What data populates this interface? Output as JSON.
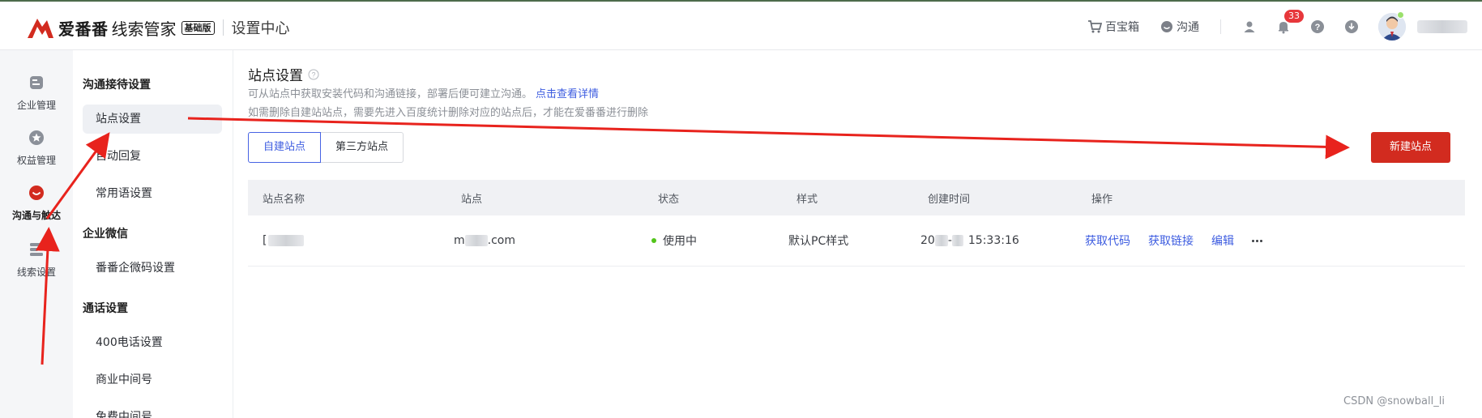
{
  "header": {
    "brand_name": "爱番番",
    "brand_sub": "线索管家",
    "edition": "基础版",
    "section_title": "设置中心",
    "links": [
      {
        "label": "百宝箱",
        "icon": "cart-icon"
      },
      {
        "label": "沟通",
        "icon": "chat-icon"
      }
    ],
    "notification_count": "33",
    "colors": {
      "brand_red": "#d22b1f"
    }
  },
  "rail": {
    "items": [
      {
        "label": "企业管理",
        "icon": "enterprise-icon"
      },
      {
        "label": "权益管理",
        "icon": "star-badge-icon"
      },
      {
        "label": "沟通与触达",
        "icon": "chat-bubble-icon",
        "active": true
      },
      {
        "label": "线索设置",
        "icon": "list-settings-icon"
      }
    ]
  },
  "submenu": {
    "group1": "沟通接待设置",
    "item_site": "站点设置",
    "item_autoreply": "自动回复",
    "item_phrases": "常用语设置",
    "group2": "企业微信",
    "item_wecom_code": "番番企微码设置",
    "group3": "通话设置",
    "item_400": "400电话设置",
    "item_business_no": "商业中间号",
    "item_free_no": "免费中间号"
  },
  "main": {
    "title": "站点设置",
    "desc1": "可从站点中获取安装代码和沟通链接，部署后便可建立沟通。",
    "desc1_link": "点击查看详情",
    "desc2": "如需删除自建站站点，需要先进入百度统计删除对应的站点后，才能在爱番番进行删除",
    "tab_self": "自建站点",
    "tab_third": "第三方站点",
    "new_button": "新建站点",
    "table": {
      "headers": [
        "站点名称",
        "站点",
        "状态",
        "样式",
        "创建时间",
        "操作"
      ],
      "row": {
        "name_prefix": "[",
        "site_prefix": "m",
        "site_suffix": ".com",
        "status": "使用中",
        "style": "默认PC样式",
        "created_prefix": "20",
        "created_mid": "-",
        "created_time": "15:33:16",
        "actions": [
          "获取代码",
          "获取链接",
          "编辑"
        ]
      }
    }
  },
  "watermark": "CSDN @snowball_li"
}
